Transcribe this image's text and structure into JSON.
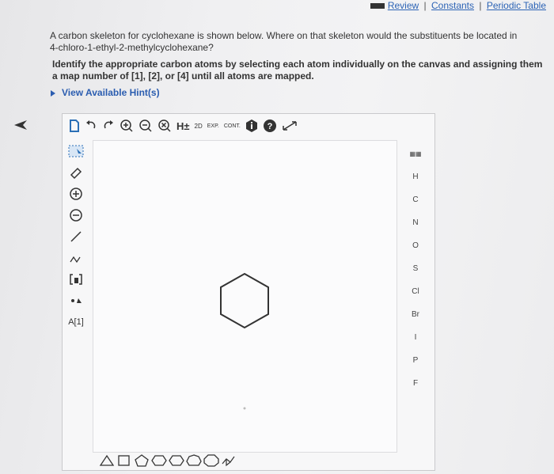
{
  "top_links": {
    "review": "Review",
    "constants": "Constants",
    "periodic": "Periodic Table",
    "sep": "|"
  },
  "question": "A carbon skeleton for cyclohexane is shown below. Where on that skeleton would the substituents be located in 4-chloro-1-ethyl-2-methylcyclohexane?",
  "instruction": "Identify the appropriate carbon atoms by selecting each atom individually on the canvas and assigning them a map number of [1], [2], or [4] until all atoms are mapped.",
  "hints_link": "View Available Hint(s)",
  "toolbar": {
    "h_label": "H±",
    "two_d": "2D",
    "exp": "EXP.",
    "cont": "CONT."
  },
  "left_tools": {
    "atom_map": "A[1]"
  },
  "elements": [
    "H",
    "C",
    "N",
    "O",
    "S",
    "Cl",
    "Br",
    "I",
    "P",
    "F"
  ],
  "colors": {
    "link": "#2c63b5",
    "text": "#333333"
  }
}
